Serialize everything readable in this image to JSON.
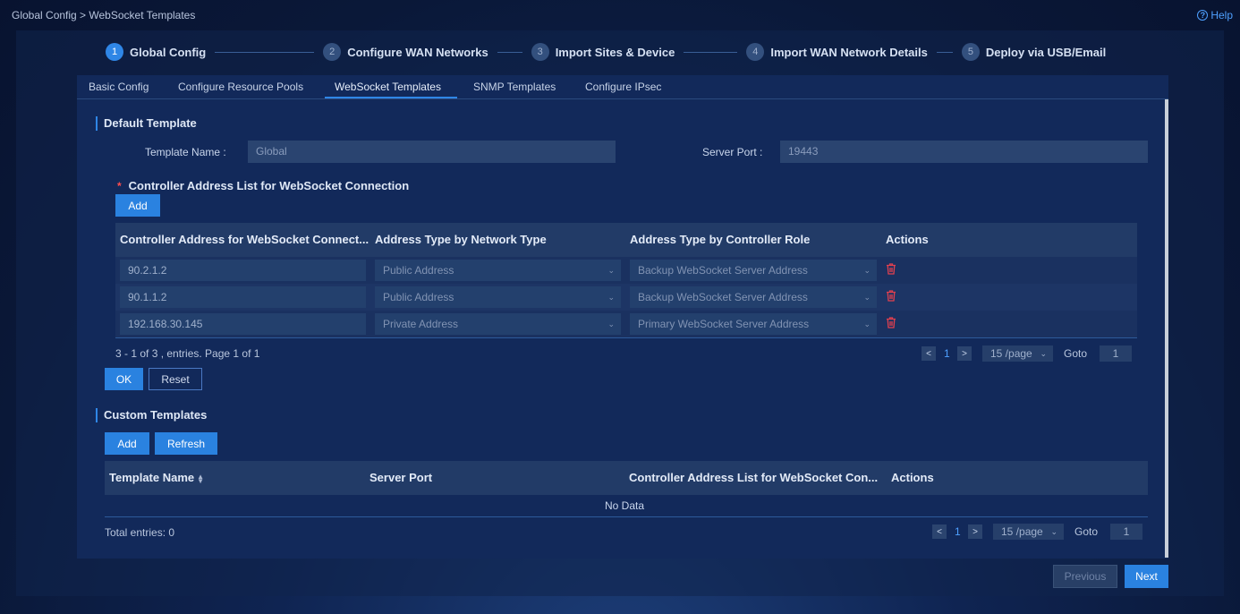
{
  "breadcrumb": "Global Config > WebSocket Templates",
  "help_label": "Help",
  "steps": [
    {
      "num": "1",
      "label": "Global Config"
    },
    {
      "num": "2",
      "label": "Configure WAN Networks"
    },
    {
      "num": "3",
      "label": "Import Sites & Device"
    },
    {
      "num": "4",
      "label": "Import WAN Network Details"
    },
    {
      "num": "5",
      "label": "Deploy via USB/Email"
    }
  ],
  "tabs": [
    "Basic Config",
    "Configure Resource Pools",
    "WebSocket Templates",
    "SNMP Templates",
    "Configure IPsec"
  ],
  "default_template": {
    "title": "Default Template",
    "template_name_label": "Template Name",
    "template_name_value": "Global",
    "server_port_label": "Server Port",
    "server_port_value": "19443",
    "controller_list_label": "Controller Address List for WebSocket Connection",
    "add_label": "Add",
    "columns": [
      "Controller Address for WebSocket Connect...",
      "Address Type by Network Type",
      "Address Type by Controller Role",
      "Actions"
    ],
    "rows": [
      {
        "address": "90.2.1.2",
        "network_type": "Public Address",
        "role": "Backup WebSocket Server Address"
      },
      {
        "address": "90.1.1.2",
        "network_type": "Public Address",
        "role": "Backup WebSocket Server Address"
      },
      {
        "address": "192.168.30.145",
        "network_type": "Private Address",
        "role": "Primary WebSocket Server Address"
      }
    ],
    "pager_info": "3 - 1 of 3 , entries. Page 1 of 1",
    "page": "1",
    "page_size": "15 /page",
    "goto_label": "Goto",
    "goto_value": "1",
    "ok_label": "OK",
    "reset_label": "Reset"
  },
  "custom_templates": {
    "title": "Custom Templates",
    "add_label": "Add",
    "refresh_label": "Refresh",
    "columns": [
      "Template Name",
      "Server Port",
      "Controller Address List for WebSocket Con...",
      "Actions"
    ],
    "no_data": "No Data",
    "total": "Total entries: 0",
    "page": "1",
    "page_size": "15 /page",
    "goto_label": "Goto",
    "goto_value": "1"
  },
  "footer": {
    "previous_label": "Previous",
    "next_label": "Next"
  },
  "colors": {
    "accent": "#2f86e6",
    "danger": "#e0404f"
  }
}
